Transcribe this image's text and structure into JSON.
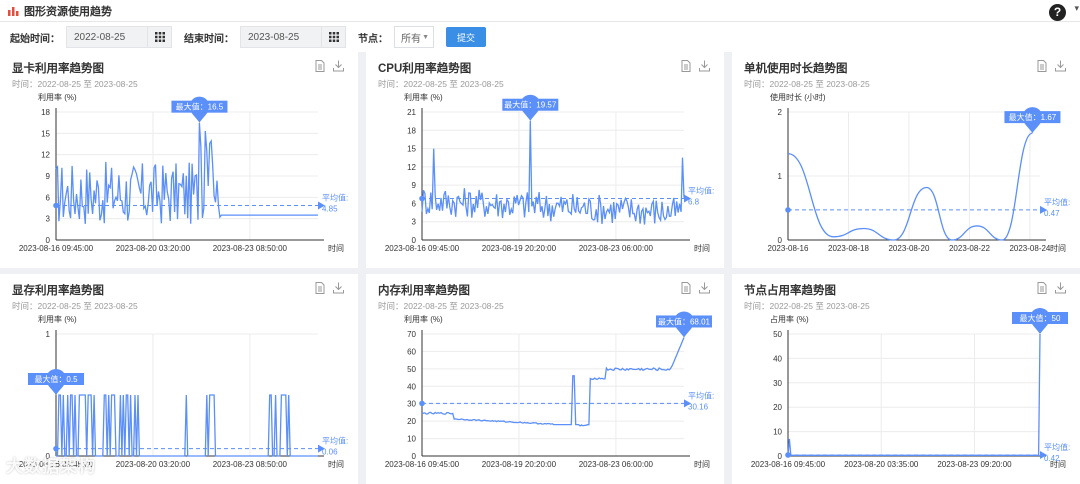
{
  "header": {
    "title": "图形资源使用趋势",
    "help_label": "?"
  },
  "filters": {
    "start_label": "起始时间：",
    "start_value": "2022-08-25",
    "end_label": "结束时间：",
    "end_value": "2023-08-25",
    "node_label": "节点：",
    "node_value": "所有",
    "submit_label": "提交"
  },
  "colors": {
    "line": "#5b8ff9",
    "accent": "#3a8ee6",
    "axis": "#333333",
    "grid": "#e6e6e6"
  },
  "panels": [
    {
      "title": "显卡利用率趋势图",
      "subtitle": "时间：2022-08-25 至 2023-08-25"
    },
    {
      "title": "CPU利用率趋势图",
      "subtitle": "时间：2022-08-25 至 2023-08-25"
    },
    {
      "title": "单机使用时长趋势图",
      "subtitle": "时间：2022-08-25 至 2023-08-25"
    },
    {
      "title": "显存利用率趋势图",
      "subtitle": "时间：2022-08-25 至 2023-08-25"
    },
    {
      "title": "内存利用率趋势图",
      "subtitle": "时间：2022-08-25 至 2023-08-25"
    },
    {
      "title": "节点占用率趋势图",
      "subtitle": "时间：2022-08-25 至 2023-08-25"
    }
  ],
  "watermark": "大数据架构",
  "chart_data": [
    {
      "type": "line",
      "ylabel": "利用率 (%)",
      "xlabel": "时间",
      "yticks": [
        "0",
        "3",
        "6",
        "9",
        "12",
        "15",
        "18"
      ],
      "ylim": [
        0,
        18
      ],
      "xticks": [
        "2023-08-16 09:45:00",
        "2023-08-20 03:20:00",
        "2023-08-23 08:50:00"
      ],
      "max_label": "最大值",
      "max_value": "16.5",
      "avg_label": "平均值:",
      "avg_value": "4.85"
    },
    {
      "type": "line",
      "ylabel": "利用率 (%)",
      "xlabel": "时间",
      "yticks": [
        "0",
        "3",
        "6",
        "9",
        "12",
        "15",
        "18",
        "21"
      ],
      "ylim": [
        0,
        21
      ],
      "xticks": [
        "2023-08-16 09:45:00",
        "2023-08-19 20:20:00",
        "2023-08-23 06:00:00"
      ],
      "max_label": "最大值",
      "max_value": "19.57",
      "avg_label": "平均值:",
      "avg_value": "6.8"
    },
    {
      "type": "line",
      "ylabel": "使用时长 (小时)",
      "xlabel": "时间",
      "yticks": [
        "0",
        "1",
        "2"
      ],
      "ylim": [
        0,
        2
      ],
      "xticks": [
        "2023-08-16",
        "2023-08-18",
        "2023-08-20",
        "2023-08-22",
        "2023-08-24"
      ],
      "max_label": "最大值",
      "max_value": "1.67",
      "avg_label": "平均值:",
      "avg_value": "0.47"
    },
    {
      "type": "line",
      "ylabel": "利用率 (%)",
      "xlabel": "时间",
      "yticks": [
        "0",
        "1"
      ],
      "ylim": [
        0,
        1
      ],
      "xticks": [
        "2023-08-16 09:45:00",
        "2023-08-20 03:20:00",
        "2023-08-23 08:50:00"
      ],
      "max_label": "最大值",
      "max_value": "0.5",
      "avg_label": "平均值:",
      "avg_value": "0.06"
    },
    {
      "type": "line",
      "ylabel": "利用率 (%)",
      "xlabel": "时间",
      "yticks": [
        "0",
        "10",
        "20",
        "30",
        "40",
        "50",
        "60",
        "70"
      ],
      "ylim": [
        0,
        70
      ],
      "xticks": [
        "2023-08-16 09:45:00",
        "2023-08-19 20:20:00",
        "2023-08-23 06:00:00"
      ],
      "max_label": "最大值",
      "max_value": "68.01",
      "avg_label": "平均值:",
      "avg_value": "30.16"
    },
    {
      "type": "line",
      "ylabel": "占用率 (%)",
      "xlabel": "时间",
      "yticks": [
        "0",
        "10",
        "20",
        "30",
        "40",
        "50"
      ],
      "ylim": [
        0,
        50
      ],
      "xticks": [
        "2023-08-16 09:45:00",
        "2023-08-20 03:35:00",
        "2023-08-23 09:20:00"
      ],
      "max_label": "最大值",
      "max_value": "50",
      "avg_label": "平均值:",
      "avg_value": "0.42"
    }
  ]
}
